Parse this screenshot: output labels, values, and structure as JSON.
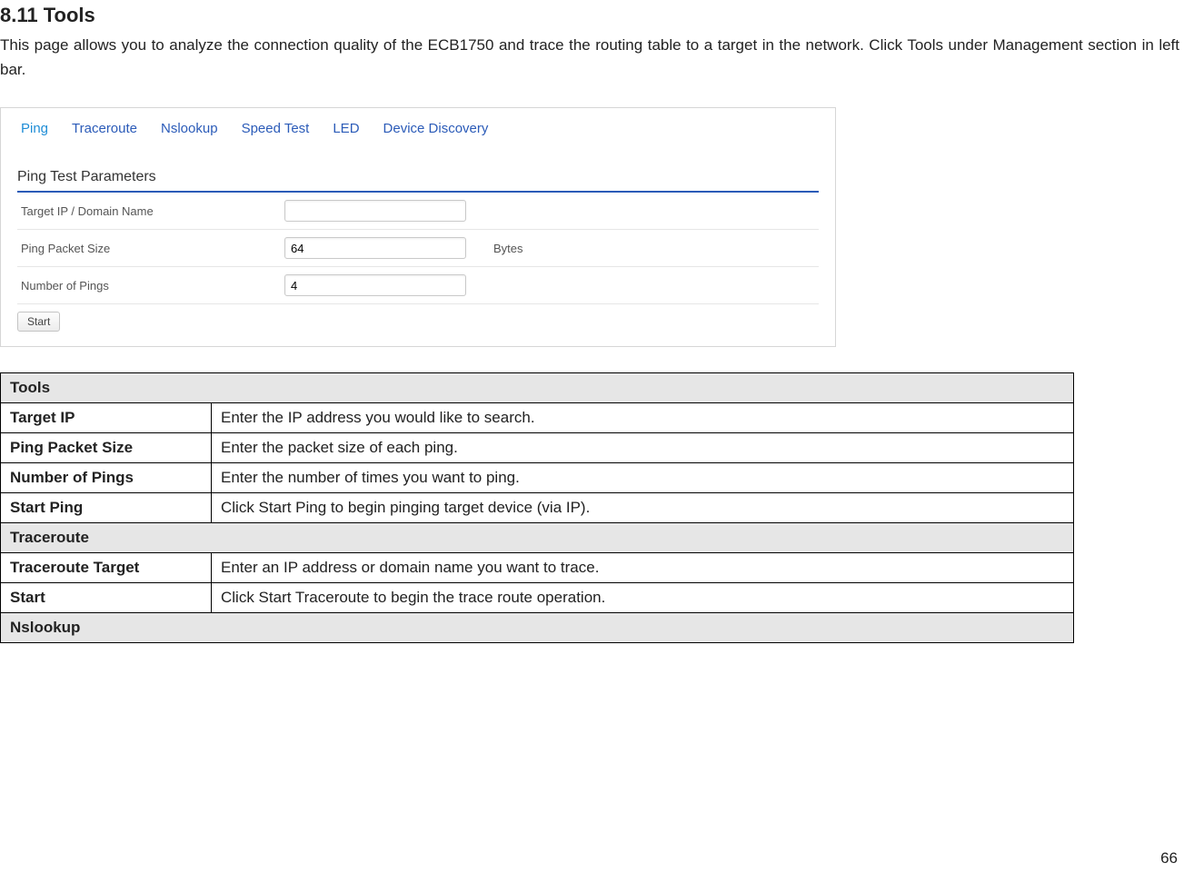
{
  "heading": "8.11 Tools",
  "intro": "This page allows you to analyze the connection quality of the ECB1750 and trace the routing table to a target in the network. Click Tools under Management section in left bar.",
  "tabs": {
    "ping": "Ping",
    "traceroute": "Traceroute",
    "nslookup": "Nslookup",
    "speedtest": "Speed Test",
    "led": "LED",
    "discovery": "Device Discovery"
  },
  "panel": {
    "title": "Ping Test Parameters",
    "rows": {
      "target_label": "Target IP / Domain Name",
      "target_value": "",
      "packet_label": "Ping Packet Size",
      "packet_value": "64",
      "packet_unit": "Bytes",
      "count_label": "Number of Pings",
      "count_value": "4"
    },
    "start_label": "Start"
  },
  "desc": {
    "tools_header": "Tools",
    "target_ip_label": "Target IP",
    "target_ip_desc": "Enter the IP address you would like to search.",
    "packet_label": "Ping Packet Size",
    "packet_desc": "Enter the packet size of each ping.",
    "count_label": "Number of Pings",
    "count_desc": "Enter the number of times you want to ping.",
    "startping_label": "Start Ping",
    "startping_desc": "Click Start Ping to begin pinging target device (via IP).",
    "traceroute_header": "Traceroute",
    "trtarget_label": "Traceroute Target",
    "trtarget_desc": "Enter an IP address or domain name you want to trace.",
    "trstart_label": "Start",
    "trstart_desc": "Click Start Traceroute to begin the trace route operation.",
    "nslookup_header": "Nslookup"
  },
  "page_number": "66"
}
